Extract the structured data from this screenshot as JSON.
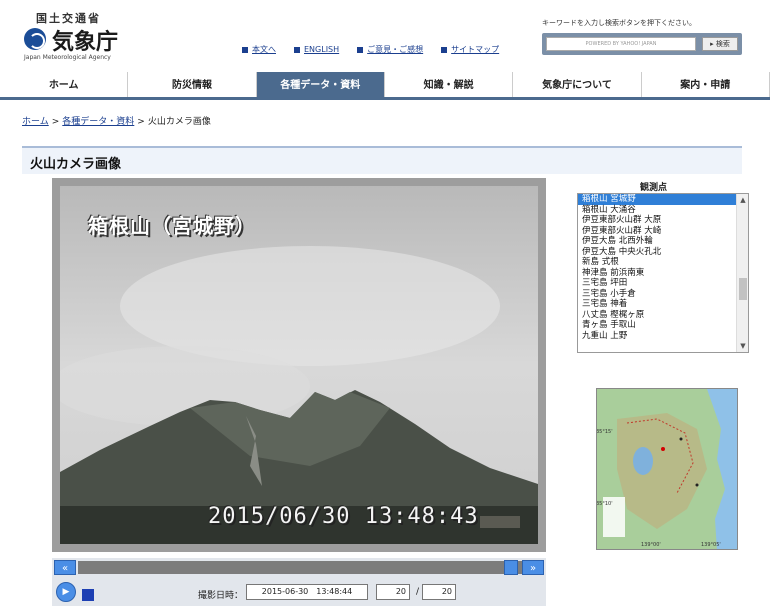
{
  "header": {
    "ministry": "国土交通省",
    "agency_name": "気象庁",
    "agency_name_en": "Japan Meteorological Agency",
    "logo_color": "#1b4d97",
    "links": [
      {
        "label": "本文へ"
      },
      {
        "label": "ENGLISH"
      },
      {
        "label": "ご意見・ご感想"
      },
      {
        "label": "サイトマップ"
      }
    ],
    "search": {
      "hint": "キーワードを入力し検索ボタンを押下ください。",
      "placeholder": "POWERED BY YAHOO! JAPAN",
      "button_label": "検索"
    }
  },
  "nav": {
    "active_color": "#4b6a8e",
    "tabs": [
      {
        "label": "ホーム",
        "active": false
      },
      {
        "label": "防災情報",
        "active": false
      },
      {
        "label": "各種データ・資料",
        "active": true
      },
      {
        "label": "知識・解説",
        "active": false
      },
      {
        "label": "気象庁について",
        "active": false
      },
      {
        "label": "案内・申請",
        "active": false
      }
    ]
  },
  "breadcrumb": {
    "items": [
      "ホーム",
      "各種データ・資料"
    ],
    "current": "火山カメラ画像",
    "separator": ">"
  },
  "page": {
    "title": "火山カメラ画像"
  },
  "camera": {
    "overlay_title": "箱根山（宮城野）",
    "overlay_timestamp": "2015/06/30 13:48:43",
    "controls": {
      "prev_icon": "double-left-arrow-icon",
      "next_icon": "double-right-arrow-icon",
      "datetime_label": "撮影日時：",
      "datetime_value": "2015-06-30　13:48:44",
      "frame_current": "20",
      "frame_separator": "/",
      "frame_total": "20"
    }
  },
  "stations": {
    "heading": "観測点",
    "items": [
      "箱根山 宮城野",
      "箱根山 大涌谷",
      "伊豆東部火山群 大原",
      "伊豆東部火山群 大崎",
      "伊豆大島 北西外輪",
      "伊豆大島 中央火孔北",
      "新島 式根",
      "神津島 前浜南東",
      "三宅島 坪田",
      "三宅島 小手倉",
      "三宅島 神着",
      "八丈島 樫梶ヶ原",
      "青ヶ島 手取山",
      "九重山 上野"
    ],
    "selected_index": 0,
    "selected_color": "#2f7fd7"
  },
  "map": {
    "ticks": [
      "139°00'",
      "139°05'",
      "35°15'",
      "35°10'"
    ],
    "sea_color": "#8fc1e8",
    "land_color": "#a9ce9b"
  }
}
